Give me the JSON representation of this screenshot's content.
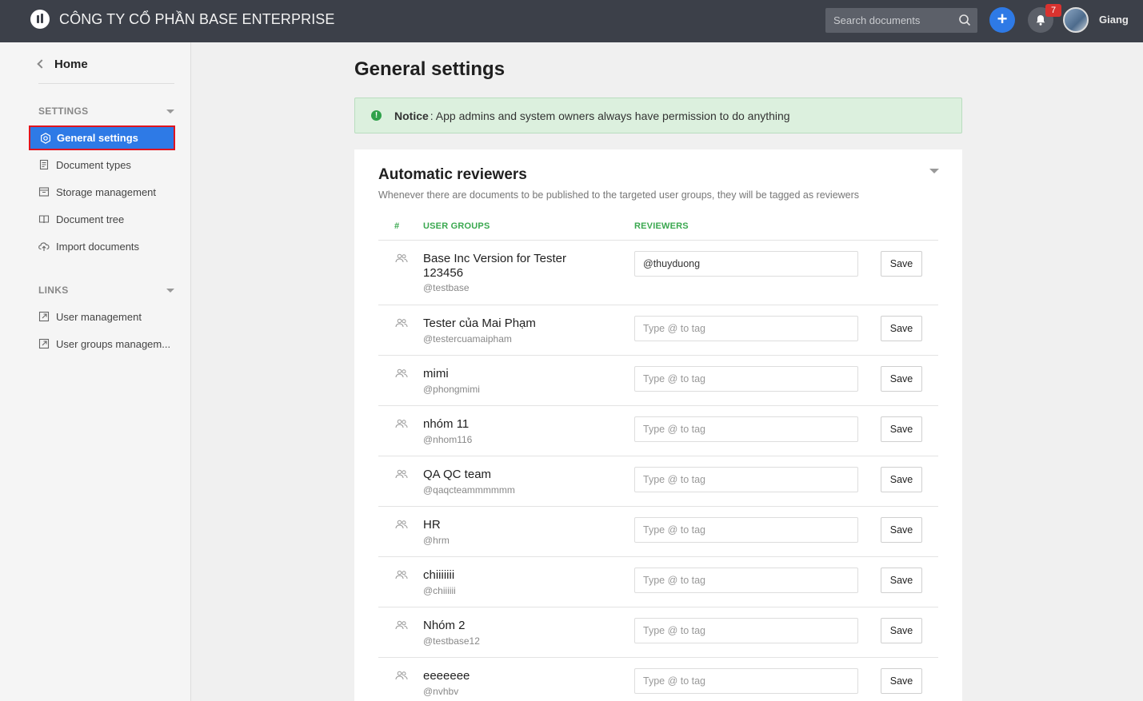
{
  "header": {
    "company": "CÔNG TY CỔ PHẦN BASE ENTERPRISE",
    "search_placeholder": "Search documents",
    "notification_count": "7",
    "user_name": "Giang"
  },
  "sidebar": {
    "home_label": "Home",
    "settings_title": "SETTINGS",
    "settings_items": [
      {
        "label": "General settings",
        "icon": "gear-icon",
        "active": true
      },
      {
        "label": "Document types",
        "icon": "document-icon"
      },
      {
        "label": "Storage management",
        "icon": "storage-icon"
      },
      {
        "label": "Document tree",
        "icon": "book-icon"
      },
      {
        "label": "Import documents",
        "icon": "cloud-upload-icon"
      }
    ],
    "links_title": "LINKS",
    "links_items": [
      {
        "label": "User management",
        "icon": "external-link-icon"
      },
      {
        "label": "User groups managem...",
        "icon": "external-link-icon"
      }
    ]
  },
  "main": {
    "title": "General settings",
    "notice_label": "Notice",
    "notice_text": ": App admins and system owners always have permission to do anything",
    "section": {
      "title": "Automatic reviewers",
      "subtitle": "Whenever there are documents to be published to the targeted user groups, they will be tagged as reviewers",
      "columns": [
        "#",
        "USER GROUPS",
        "REVIEWERS"
      ],
      "input_placeholder": "Type @ to tag",
      "save_label": "Save",
      "rows": [
        {
          "name": "Base Inc Version for Tester 123456",
          "handle": "@testbase",
          "reviewer": "@thuyduong"
        },
        {
          "name": "Tester của Mai Phạm",
          "handle": "@testercuamaipham",
          "reviewer": ""
        },
        {
          "name": "mimi",
          "handle": "@phongmimi",
          "reviewer": ""
        },
        {
          "name": "nhóm 11",
          "handle": "@nhom116",
          "reviewer": ""
        },
        {
          "name": "QA QC team",
          "handle": "@qaqcteammmmmm",
          "reviewer": ""
        },
        {
          "name": "HR",
          "handle": "@hrm",
          "reviewer": ""
        },
        {
          "name": "chiiiiiii",
          "handle": "@chiiiiii",
          "reviewer": ""
        },
        {
          "name": "Nhóm 2",
          "handle": "@testbase12",
          "reviewer": ""
        },
        {
          "name": "eeeeeee",
          "handle": "@nvhbv",
          "reviewer": ""
        }
      ]
    }
  },
  "colors": {
    "topbar": "#3c4049",
    "accent": "#2e7ae6",
    "notice_bg": "#dcf0de",
    "header_green": "#3aa84f",
    "badge_red": "#d9322f"
  }
}
